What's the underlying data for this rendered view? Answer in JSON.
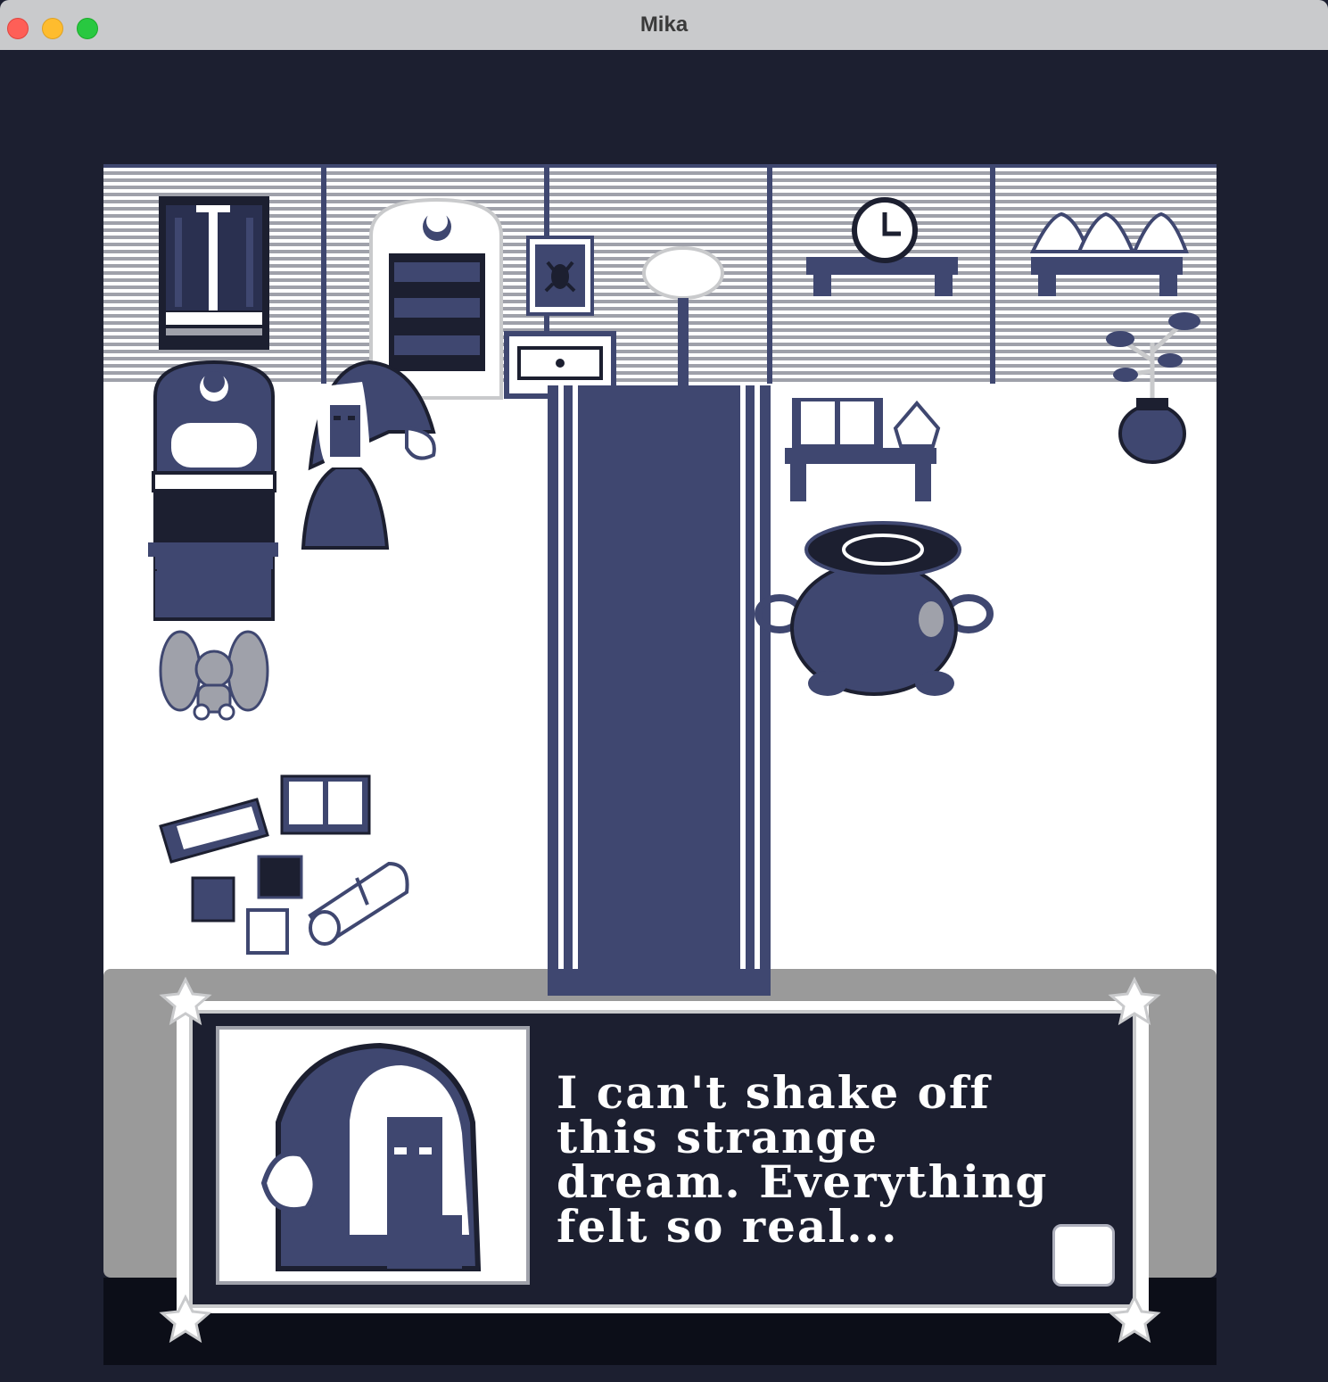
{
  "window": {
    "title": "Mika",
    "controls": [
      "close",
      "minimize",
      "maximize"
    ]
  },
  "scene": {
    "room": "bedroom",
    "objects": [
      "window-icon",
      "bookshelf-icon",
      "spider-frame-icon",
      "drawer-icon",
      "moon-lamp-icon",
      "clock-icon",
      "potion-shelf-icon",
      "potted-plant-icon",
      "bed-icon",
      "player-witch-sprite",
      "plush-bunny-icon",
      "open-book-table-icon",
      "cauldron-icon",
      "books-pile-icon",
      "scroll-icon",
      "rug"
    ]
  },
  "dialog": {
    "text": "I can't shake off this strange dream. Everything felt so real...",
    "portrait": "witch-portrait-icon",
    "next_button": "advance-dialog-button"
  },
  "colors": {
    "navy": "#1c1f30",
    "slate": "#3f4770",
    "white": "#ffffff",
    "gray": "#999999"
  }
}
